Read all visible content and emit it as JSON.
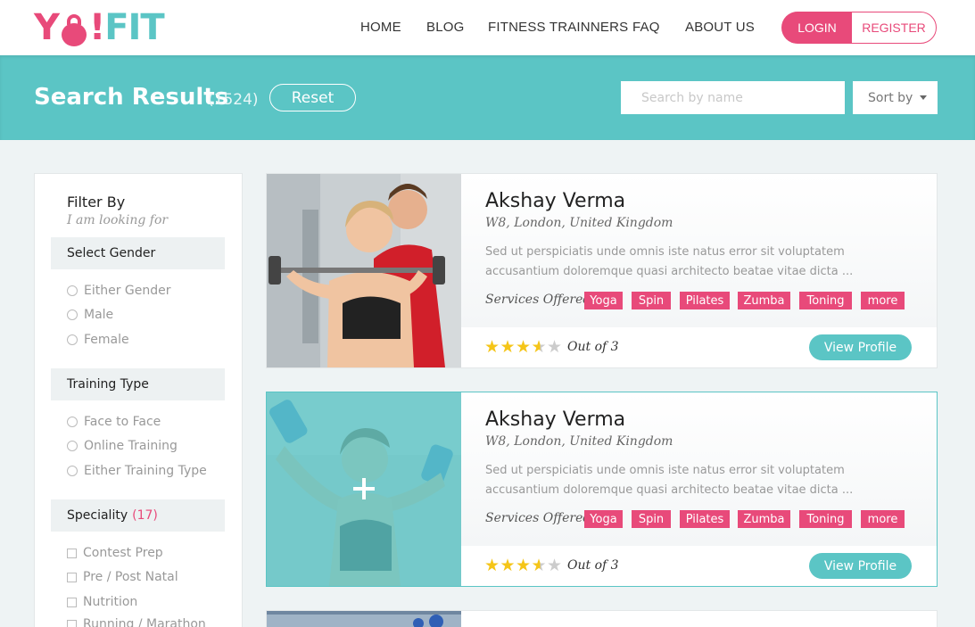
{
  "brand": {
    "logo_y": "Y",
    "logo_excl": "!",
    "logo_fit": "FIT"
  },
  "nav": {
    "items": [
      "HOME",
      "BLOG",
      "FITNESS TRAINNERS",
      "FAQ",
      "ABOUT US"
    ],
    "login": "LOGIN",
    "register": "REGISTER"
  },
  "header": {
    "title": "Search Results",
    "count": "(1524)",
    "reset": "Reset",
    "search_placeholder": "Search by name",
    "sort_label": "Sort by"
  },
  "filters": {
    "title": "Filter By",
    "subtitle": "I am looking for",
    "gender": {
      "label": "Select Gender",
      "options": [
        "Either Gender",
        "Male",
        "Female"
      ]
    },
    "training": {
      "label": "Training Type",
      "options": [
        "Face to Face",
        "Online Training",
        "Either Training Type"
      ]
    },
    "speciality": {
      "label": "Speciality",
      "count": "(17)",
      "options": [
        "Contest Prep",
        "Pre / Post Natal",
        "Nutrition",
        "Running / Marathon"
      ]
    }
  },
  "results": [
    {
      "name": "Akshay Verma",
      "location": "W8, London, United Kingdom",
      "description": "Sed ut perspiciatis unde omnis iste natus error sit voluptatem accusantium doloremque quasi architecto beatae vitae dicta ...",
      "services_label": "Services Offered",
      "services": [
        "Yoga",
        "Spin",
        "Pilates",
        "Zumba",
        "Toning",
        "more"
      ],
      "rating": 3.5,
      "rating_text": "Out of 3",
      "view_label": "View Profile"
    },
    {
      "name": "Akshay Verma",
      "location": "W8, London, United Kingdom",
      "description": "Sed ut perspiciatis unde omnis iste natus error sit voluptatem accusantium doloremque quasi architecto beatae vitae dicta ...",
      "services_label": "Services Offered",
      "services": [
        "Yoga",
        "Spin",
        "Pilates",
        "Zumba",
        "Toning",
        "more"
      ],
      "rating": 3.5,
      "rating_text": "Out of 3",
      "view_label": "View Profile"
    }
  ],
  "colors": {
    "teal": "#5bc5c5",
    "pink": "#e84a7a",
    "star": "#f5c518"
  }
}
